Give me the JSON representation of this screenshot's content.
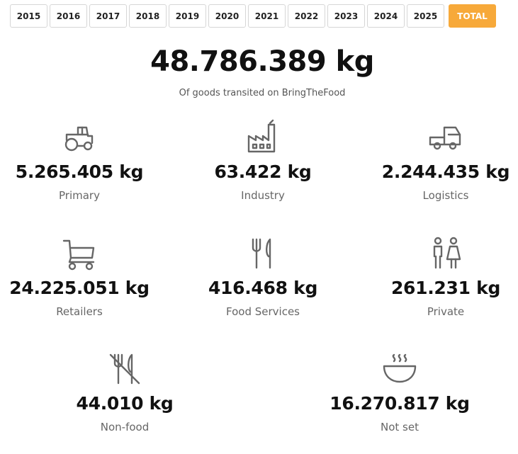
{
  "tabs": [
    "2015",
    "2016",
    "2017",
    "2018",
    "2019",
    "2020",
    "2021",
    "2022",
    "2023",
    "2024",
    "2025",
    "TOTAL"
  ],
  "active_tab": "TOTAL",
  "headline": {
    "total": "48.786.389 kg",
    "subtitle": "Of goods transited on BringTheFood"
  },
  "stats": [
    {
      "icon": "tractor-icon",
      "value": "5.265.405 kg",
      "label": "Primary"
    },
    {
      "icon": "factory-icon",
      "value": "63.422 kg",
      "label": "Industry"
    },
    {
      "icon": "truck-icon",
      "value": "2.244.435 kg",
      "label": "Logistics"
    },
    {
      "icon": "shopping-cart-icon",
      "value": "24.225.051 kg",
      "label": "Retailers"
    },
    {
      "icon": "fork-knife-icon",
      "value": "416.468 kg",
      "label": "Food Services"
    },
    {
      "icon": "people-icon",
      "value": "261.231 kg",
      "label": "Private"
    },
    {
      "icon": "no-food-icon",
      "value": "44.010 kg",
      "label": "Non-food"
    },
    {
      "icon": "hot-bowl-icon",
      "value": "16.270.817 kg",
      "label": "Not set"
    }
  ],
  "colors": {
    "accent": "#f7a93a",
    "icon": "#666666",
    "text": "#111111",
    "muted": "#555555"
  }
}
